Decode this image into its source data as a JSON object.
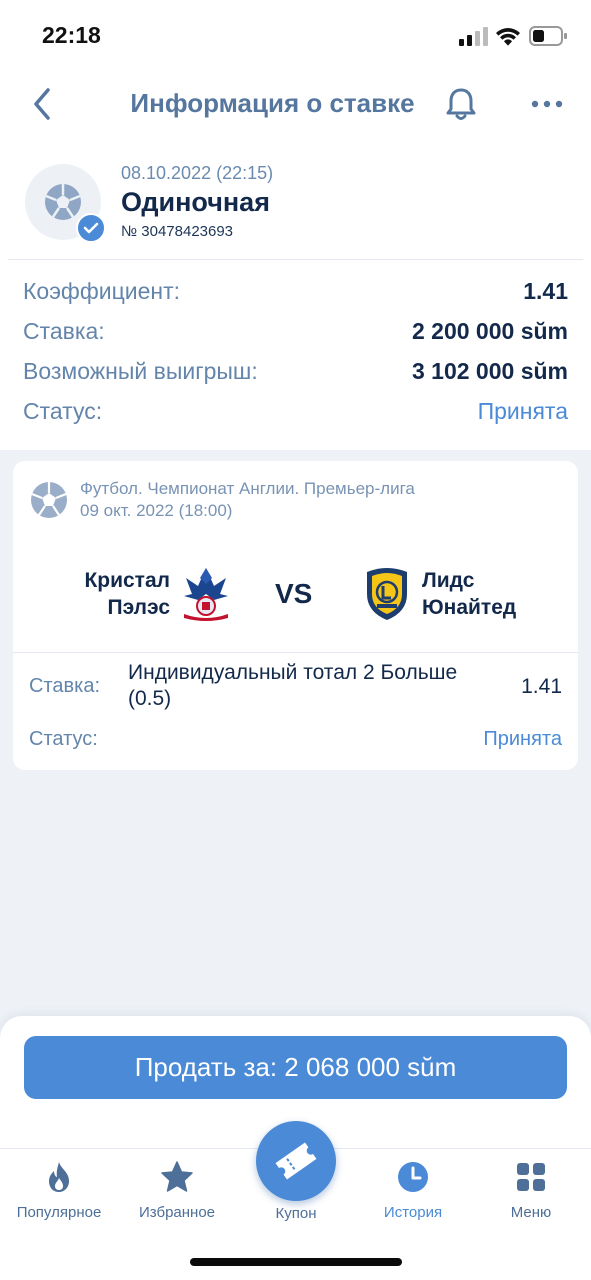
{
  "status_bar": {
    "time": "22:18"
  },
  "nav": {
    "title": "Информация о ставке"
  },
  "bet": {
    "datetime": "08.10.2022 (22:15)",
    "type": "Одиночная",
    "number": "№ 30478423693",
    "rows": [
      {
        "label": "Коэффициент:",
        "value": "1.41"
      },
      {
        "label": "Ставка:",
        "value": "2 200 000 sŭm"
      },
      {
        "label": "Возможный выигрыш:",
        "value": "3 102 000 sŭm"
      },
      {
        "label": "Статус:",
        "value": "Принята"
      }
    ]
  },
  "event": {
    "league": "Футбол. Чемпионат Англии. Премьер-лига",
    "date": "09 окт. 2022 (18:00)",
    "home_line1": "Кристал",
    "home_line2": "Пэлэс",
    "vs": "VS",
    "away_line1": "Лидс",
    "away_line2": "Юнайтед",
    "selection_label": "Ставка:",
    "selection_market": "Индивидуальный тотал 2 Больше (0.5)",
    "selection_odds": "1.41",
    "status_label": "Статус:",
    "status_value": "Принята"
  },
  "sell_button": "Продать за: 2 068 000 sŭm",
  "tabs": {
    "popular": "Популярное",
    "favorites": "Избранное",
    "coupon": "Купон",
    "history": "История",
    "menu": "Меню"
  },
  "colors": {
    "accent": "#4a8ad6",
    "title": "#55779f",
    "text_dark": "#13294b",
    "label": "#6485ab",
    "background": "#eef1f6"
  }
}
